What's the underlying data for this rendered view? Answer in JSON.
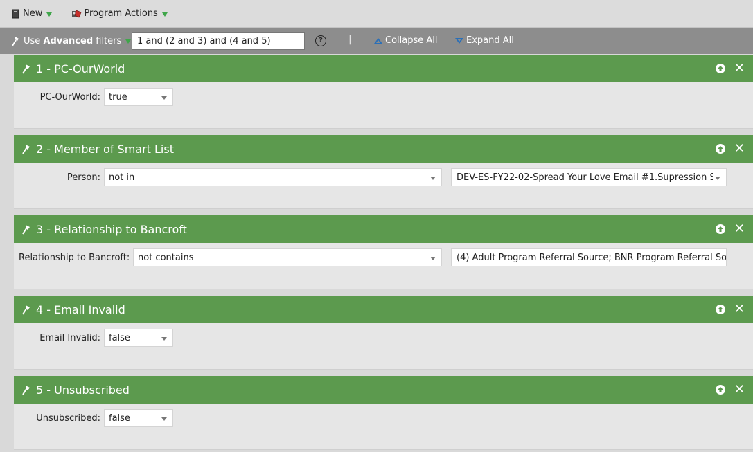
{
  "toolbar": {
    "new_label": "New",
    "program_actions_label": "Program Actions"
  },
  "filterbar": {
    "use_label": "Use",
    "advanced_label": "Advanced",
    "filters_label": "filters",
    "logic_value": "1 and (2 and 3) and (4 and 5)",
    "help_symbol": "?",
    "separator": "|",
    "collapse_label": "Collapse All",
    "expand_label": "Expand All"
  },
  "filters": [
    {
      "title": "1 - PC-OurWorld",
      "label": "PC-OurWorld:",
      "value": "true"
    },
    {
      "title": "2 - Member of Smart List",
      "label": "Person:",
      "operator": "not in",
      "value": "DEV-ES-FY22-02-Spread Your Love Email #1.Supression S"
    },
    {
      "title": "3 - Relationship to Bancroft",
      "label": "Relationship to Bancroft:",
      "operator": "not contains",
      "value": "(4) Adult Program Referral Source; BNR Program Referral Sou"
    },
    {
      "title": "4 - Email Invalid",
      "label": "Email Invalid:",
      "value": "false"
    },
    {
      "title": "5 - Unsubscribed",
      "label": "Unsubscribed:",
      "value": "false"
    }
  ],
  "colors": {
    "header_green": "#5c9a4e",
    "filterbar_gray": "#8d8d8d",
    "link_blue": "#2a6fb8"
  }
}
